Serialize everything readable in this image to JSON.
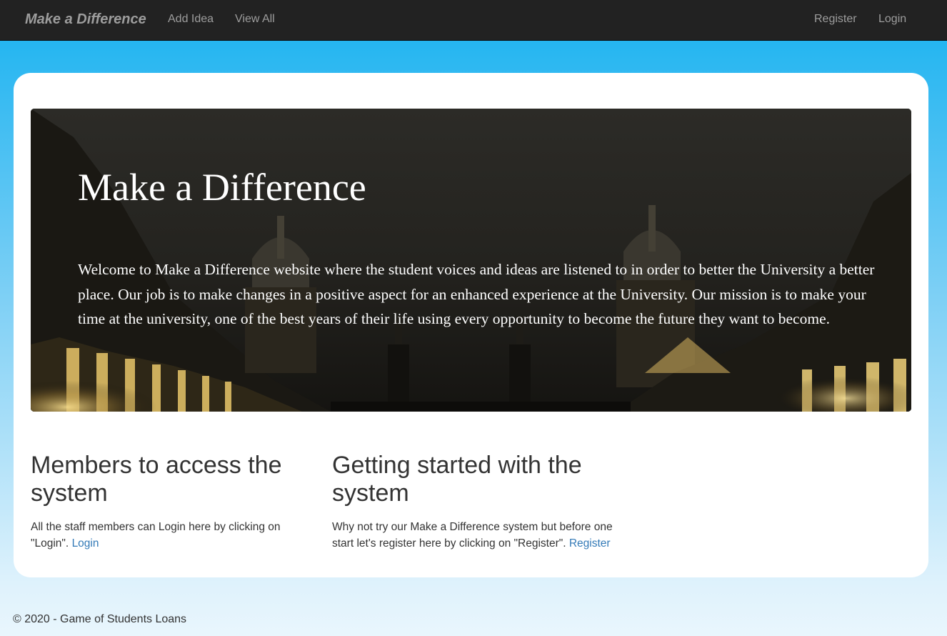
{
  "navbar": {
    "brand": "Make a Difference",
    "left_links": [
      "Add Idea",
      "View All"
    ],
    "right_links": [
      "Register",
      "Login"
    ]
  },
  "hero": {
    "title": "Make a Difference",
    "text": "Welcome to Make a Difference website where the student voices and ideas are listened to in order to better the University a better place. Our job is to make changes in a positive aspect for an enhanced experience at the University. Our mission is to make your time at the university, one of the best years of their life using every opportunity to become the future they want to become."
  },
  "columns": [
    {
      "heading": "Members to access the system",
      "text": "All the staff members can Login here by clicking on \"Login\".",
      "link": "Login"
    },
    {
      "heading": "Getting started with the system",
      "text": "Why not try our Make a Difference system but before one start let's register here by clicking on \"Register\".",
      "link": "Register"
    }
  ],
  "footer": {
    "text": "© 2020 - Game of Students Loans"
  },
  "colors": {
    "navbar_bg": "#222222",
    "nav_text": "#9d9d9d",
    "link": "#337ab7",
    "page_bg_top": "#17b2f0"
  }
}
